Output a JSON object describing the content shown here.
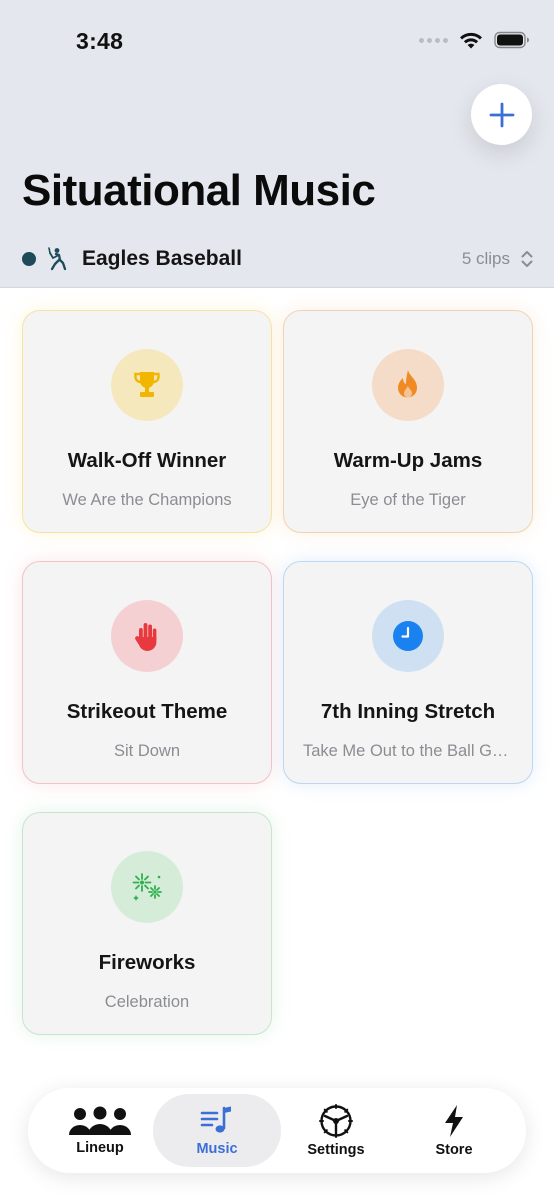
{
  "status": {
    "time": "3:48"
  },
  "header": {
    "title": "Situational Music",
    "team_name": "Eagles Baseball",
    "clip_count": "5 clips",
    "team_color": "#1e4a5a"
  },
  "cards": [
    {
      "title": "Walk-Off Winner",
      "subtitle": "We Are the Champions",
      "icon": "trophy-icon",
      "accent": "#f2b600"
    },
    {
      "title": "Warm-Up Jams",
      "subtitle": "Eye of the Tiger",
      "icon": "flame-icon",
      "accent": "#f08a24"
    },
    {
      "title": "Strikeout Theme",
      "subtitle": "Sit Down",
      "icon": "hand-raised-icon",
      "accent": "#e8393f"
    },
    {
      "title": "7th Inning Stretch",
      "subtitle": "Take Me Out to the Ball Game",
      "icon": "clock-icon",
      "accent": "#1a82f0"
    },
    {
      "title": "Fireworks",
      "subtitle": "Celebration",
      "icon": "sparkles-icon",
      "accent": "#2fb04e"
    }
  ],
  "tabs": [
    {
      "label": "Lineup",
      "icon": "people-icon",
      "active": false
    },
    {
      "label": "Music",
      "icon": "music-list-icon",
      "active": true
    },
    {
      "label": "Settings",
      "icon": "steering-wheel-icon",
      "active": false
    },
    {
      "label": "Store",
      "icon": "bolt-icon",
      "active": false
    }
  ],
  "colors": {
    "accent_blue": "#3b6fd6",
    "header_bg": "#e4e7ed"
  }
}
